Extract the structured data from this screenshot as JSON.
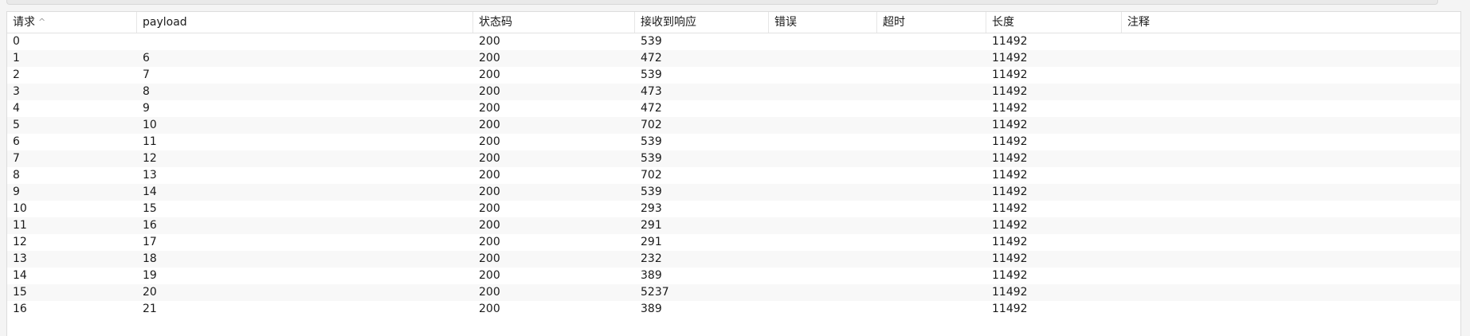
{
  "table": {
    "columns": [
      "请求",
      "payload",
      "状态码",
      "接收到响应",
      "错误",
      "超时",
      "长度",
      "注释"
    ],
    "sort_icon": "sort-ascending-icon",
    "sort_glyph": "^",
    "rows": [
      [
        "0",
        "",
        "200",
        "539",
        "",
        "",
        "11492",
        ""
      ],
      [
        "1",
        "6",
        "200",
        "472",
        "",
        "",
        "11492",
        ""
      ],
      [
        "2",
        "7",
        "200",
        "539",
        "",
        "",
        "11492",
        ""
      ],
      [
        "3",
        "8",
        "200",
        "473",
        "",
        "",
        "11492",
        ""
      ],
      [
        "4",
        "9",
        "200",
        "472",
        "",
        "",
        "11492",
        ""
      ],
      [
        "5",
        "10",
        "200",
        "702",
        "",
        "",
        "11492",
        ""
      ],
      [
        "6",
        "11",
        "200",
        "539",
        "",
        "",
        "11492",
        ""
      ],
      [
        "7",
        "12",
        "200",
        "539",
        "",
        "",
        "11492",
        ""
      ],
      [
        "8",
        "13",
        "200",
        "702",
        "",
        "",
        "11492",
        ""
      ],
      [
        "9",
        "14",
        "200",
        "539",
        "",
        "",
        "11492",
        ""
      ],
      [
        "10",
        "15",
        "200",
        "293",
        "",
        "",
        "11492",
        ""
      ],
      [
        "11",
        "16",
        "200",
        "291",
        "",
        "",
        "11492",
        ""
      ],
      [
        "12",
        "17",
        "200",
        "291",
        "",
        "",
        "11492",
        ""
      ],
      [
        "13",
        "18",
        "200",
        "232",
        "",
        "",
        "11492",
        ""
      ],
      [
        "14",
        "19",
        "200",
        "389",
        "",
        "",
        "11492",
        ""
      ],
      [
        "15",
        "20",
        "200",
        "5237",
        "",
        "",
        "11492",
        ""
      ],
      [
        "16",
        "21",
        "200",
        "389",
        "",
        "",
        "11492",
        ""
      ]
    ]
  }
}
